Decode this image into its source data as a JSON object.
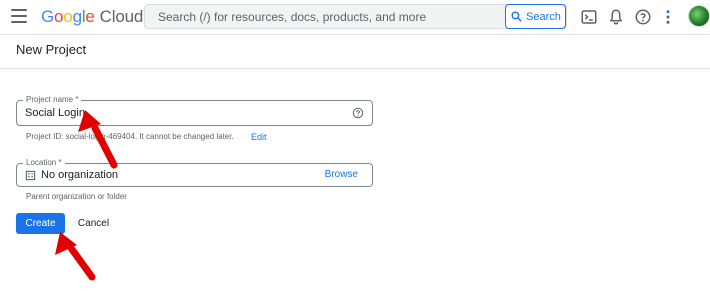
{
  "header": {
    "logo_parts": [
      "G",
      "o",
      "o",
      "g",
      "l",
      "e"
    ],
    "product": "Cloud",
    "search_placeholder": "Search (/) for resources, docs, products, and more",
    "search_button": "Search"
  },
  "page": {
    "title": "New Project"
  },
  "form": {
    "project_name": {
      "label": "Project name *",
      "value": "Social Login"
    },
    "project_id_note": "Project ID: social-login-469404. It cannot be changed later.",
    "edit_label": "Edit",
    "location": {
      "label": "Location *",
      "value": "No organization",
      "browse_label": "Browse",
      "hint": "Parent organization or folder"
    },
    "create_label": "Create",
    "cancel_label": "Cancel"
  },
  "colors": {
    "accent": "#1a73e8",
    "annotation_arrow": "#e00000"
  }
}
